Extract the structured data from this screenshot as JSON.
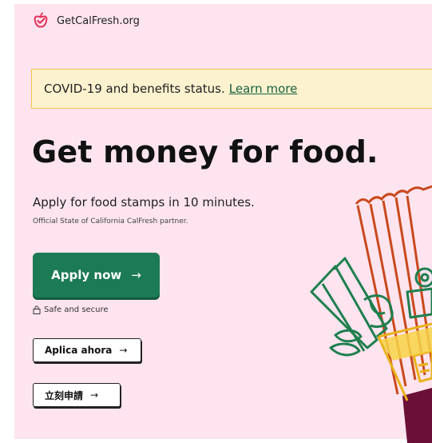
{
  "brand": {
    "name": "GetCalFresh.org",
    "accent": "#e2335a"
  },
  "notice": {
    "text": "COVID-19 and benefits status.",
    "link": "Learn more"
  },
  "hero": {
    "headline": "Get money for food.",
    "subheadline": "Apply for food stamps in 10 minutes.",
    "partner": "Official State of California CalFresh partner."
  },
  "cta": {
    "apply": "Apply now",
    "arrow": "→",
    "secure": "Safe and secure"
  },
  "languages": [
    {
      "label": "Aplica ahora"
    },
    {
      "label": "立刻申請"
    }
  ],
  "colors": {
    "page_bg": "#fde4ef",
    "primary": "#1c7a55",
    "notice_bg": "#fdf2cf",
    "notice_border": "#f2c44a"
  },
  "icons": {
    "logo": "apple-check-icon",
    "lock": "lock-icon"
  }
}
